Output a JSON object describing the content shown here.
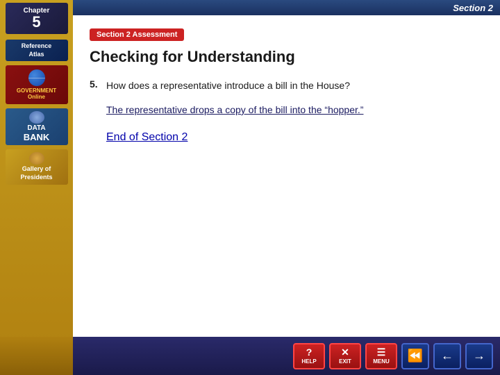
{
  "header": {
    "section_label": "Section 2"
  },
  "sidebar": {
    "chapter_label": "Chapter",
    "chapter_number": "5",
    "nav_items": [
      {
        "id": "reference-atlas",
        "line1": "Reference",
        "line2": "Atlas"
      },
      {
        "id": "government-online",
        "line1": "GOVERNMENT",
        "line2": "Online"
      },
      {
        "id": "data-bank",
        "line1": "DATA",
        "line2": "BANK"
      },
      {
        "id": "gallery-presidents",
        "line1": "Gallery of",
        "line2": "Presidents"
      }
    ]
  },
  "main": {
    "badge_text": "Section 2 Assessment",
    "title": "Checking for Understanding",
    "question": {
      "number": "5.",
      "text": "How does a representative introduce a bill in the House?"
    },
    "answer": "The representative drops a copy of the bill into the “hopper.”",
    "end_link": "End of Section 2"
  },
  "toolbar": {
    "buttons": [
      {
        "id": "help",
        "label": "HELP"
      },
      {
        "id": "exit",
        "label": "EXIT"
      },
      {
        "id": "menu",
        "label": "MENU"
      }
    ],
    "nav_buttons": [
      {
        "id": "back2",
        "icon": "⏪"
      },
      {
        "id": "back1",
        "icon": "←"
      },
      {
        "id": "forward1",
        "icon": "→"
      }
    ]
  }
}
